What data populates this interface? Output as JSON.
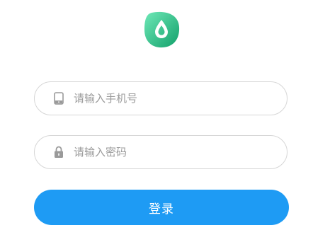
{
  "app": {
    "logo_icon": "water-drop-icon",
    "brand_color_dark": "#17a872",
    "brand_color_light": "#5fe0ae"
  },
  "form": {
    "phone": {
      "icon": "phone-icon",
      "placeholder": "请输入手机号",
      "value": ""
    },
    "password": {
      "icon": "lock-icon",
      "placeholder": "请输入密码",
      "value": ""
    },
    "login_label": "登录",
    "login_color": "#1e9bf4"
  }
}
